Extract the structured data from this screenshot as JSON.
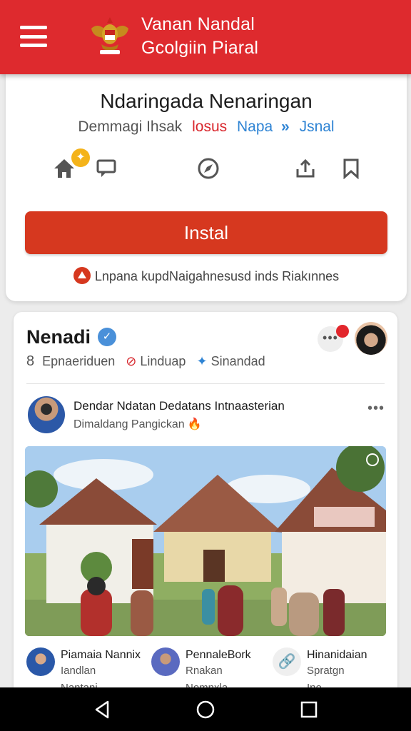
{
  "header": {
    "title_line1": "Vanan Nandal",
    "title_line2": "Gcolgiin Piaral",
    "menu_icon": "hamburger-icon",
    "emblem": "garuda-emblem"
  },
  "app": {
    "name": "Ndaringada Nenaringan",
    "developer": "Demmagi Ihsak",
    "tag_red": "losus",
    "tag_blue": "Napa",
    "tag_blue2": "Jsnal",
    "install_label": "Instal",
    "notice": "Lnpana kupdNaigahnesusd inds Riakınnes",
    "action_icons": [
      "home-icon",
      "star-badge-icon",
      "chat-icon",
      "compass-icon",
      "share-icon",
      "bookmark-icon"
    ],
    "colors": {
      "accent": "#de2a2e",
      "install": "#d6381f",
      "link": "#2f84d4"
    }
  },
  "feed": {
    "page_name": "Nenadi",
    "meta_count": "8",
    "meta_1": "Epnaeriduen",
    "meta_2": "Linduap",
    "meta_3": "Sinandad",
    "post": {
      "title": "Dendar Ndatan Dedatans Intnaasterian",
      "subtitle": "Dimaldang Pangickan"
    },
    "commenters": [
      {
        "name": "Piamaia Nannix",
        "line1": "Iandlan",
        "line2": "Nantani"
      },
      {
        "name": "PennaleBork",
        "line1": "Rnakan",
        "line2": "Nomnxla"
      },
      {
        "name": "Hinanidaian",
        "line1": "Spratgn",
        "line2": "Ine"
      }
    ]
  }
}
